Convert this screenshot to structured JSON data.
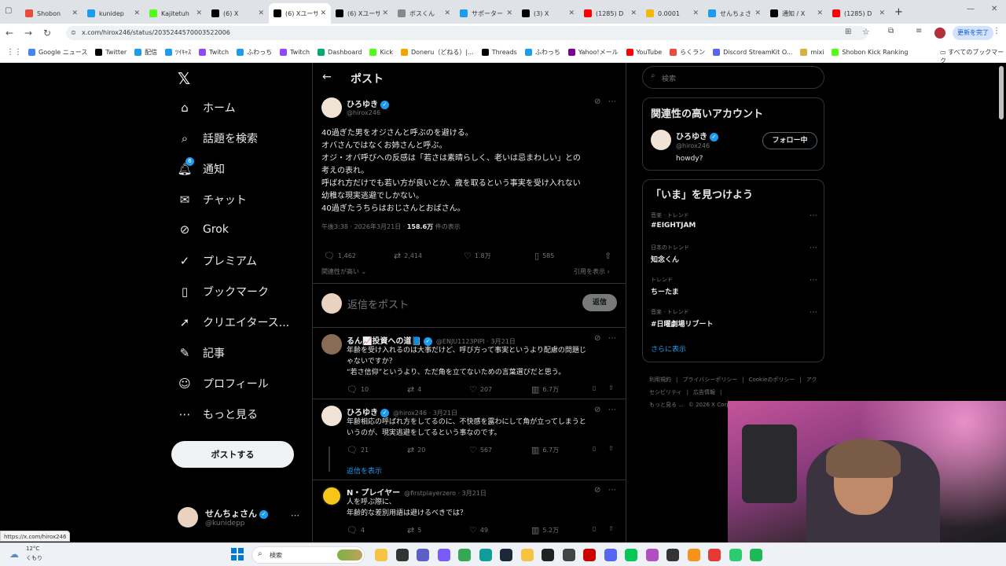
{
  "browser": {
    "tabs": [
      {
        "label": "Shobon",
        "color": "#e74c3c"
      },
      {
        "label": "kunidep",
        "color": "#1d9bf0"
      },
      {
        "label": "Kajitetuh",
        "color": "#53fc18"
      },
      {
        "label": "(6) X",
        "color": "#000"
      },
      {
        "label": "(6) Xユーザ",
        "color": "#000"
      },
      {
        "label": "(6) Xユーザ",
        "color": "#000"
      },
      {
        "label": "ボスくん",
        "color": "#888"
      },
      {
        "label": "サポーター",
        "color": "#1d9bf0"
      },
      {
        "label": "(3) X",
        "color": "#000"
      },
      {
        "label": "(1285) D",
        "color": "#ff0000"
      },
      {
        "label": "0.0001",
        "color": "#f0b90b"
      },
      {
        "label": "せんちょさ",
        "color": "#1d9bf0"
      },
      {
        "label": "通知 / X",
        "color": "#000"
      },
      {
        "label": "(1285) D",
        "color": "#ff0000"
      }
    ],
    "url": "x.com/hirox246/status/2035244570003522006",
    "update_label": "更新を完了",
    "bookmarks": [
      {
        "label": "Google ニュース",
        "color": "#4285f4"
      },
      {
        "label": "Twitter",
        "color": "#000"
      },
      {
        "label": "配信",
        "color": "#1d9bf0"
      },
      {
        "label": "ﾂｲｷｬｽ",
        "color": "#1d9bf0"
      },
      {
        "label": "Twitch",
        "color": "#9146ff"
      },
      {
        "label": "ふわっち",
        "color": "#1d9bf0"
      },
      {
        "label": "Twitch",
        "color": "#9146ff"
      },
      {
        "label": "Dashboard",
        "color": "#0a7"
      },
      {
        "label": "Kick",
        "color": "#53fc18"
      },
      {
        "label": "Doneru（どねる）|...",
        "color": "#f0a500"
      },
      {
        "label": "Threads",
        "color": "#000"
      },
      {
        "label": "ふわっち",
        "color": "#1d9bf0"
      },
      {
        "label": "Yahoo!メール",
        "color": "#7b0099"
      },
      {
        "label": "YouTube",
        "color": "#ff0000"
      },
      {
        "label": "らくラン",
        "color": "#e74c3c"
      },
      {
        "label": "Discord StreamKit O...",
        "color": "#5865f2"
      },
      {
        "label": "mixi",
        "color": "#d8b13d"
      },
      {
        "label": "Shobon Kick Ranking",
        "color": "#53fc18"
      }
    ],
    "all_bookmarks": "すべてのブックマーク"
  },
  "sidebar": {
    "items": [
      {
        "label": "ホーム",
        "icon": "home-icon",
        "glyph": "⌂"
      },
      {
        "label": "話題を検索",
        "icon": "search-icon",
        "glyph": "⌕"
      },
      {
        "label": "通知",
        "icon": "bell-icon",
        "glyph": "🔔︎"
      },
      {
        "label": "チャット",
        "icon": "mail-icon",
        "glyph": "✉"
      },
      {
        "label": "Grok",
        "icon": "grok-icon",
        "glyph": "⊘"
      },
      {
        "label": "プレミアム",
        "icon": "premium-icon",
        "glyph": "✓"
      },
      {
        "label": "ブックマーク",
        "icon": "bookmark-icon",
        "glyph": "▯"
      },
      {
        "label": "クリエイタース...",
        "icon": "rocket-icon",
        "glyph": "➚"
      },
      {
        "label": "記事",
        "icon": "article-icon",
        "glyph": "✎"
      },
      {
        "label": "プロフィール",
        "icon": "profile-icon",
        "glyph": "☺"
      },
      {
        "label": "もっと見る",
        "icon": "more-icon",
        "glyph": "⋯"
      }
    ],
    "notification_badge": "6",
    "post_button": "ポストする",
    "account": {
      "name": "せんちょさん",
      "handle": "@kunidepp"
    }
  },
  "header": {
    "title": "ポスト"
  },
  "post": {
    "author": "ひろゆき",
    "handle": "@hirox246",
    "lines": [
      "40過ぎた男をオジさんと呼ぶのを避ける。",
      "オバさんではなくお姉さんと呼ぶ。",
      "オジ・オバ呼びへの反感は「若さは素晴らしく、老いは忌まわしい」との",
      "考えの表れ。",
      "呼ばれ方だけでも若い方が良いとか、歳を取るという事実を受け入れない",
      "幼稚な現実逃避でしかない。",
      "40過ぎたうちらはおじさんとおばさん。"
    ],
    "time": "午後3:38 · 2026年3月21日 · ",
    "views": "158.6万",
    "views_suffix": " 件の表示",
    "replies": "1,462",
    "reposts": "2,414",
    "likes": "1.8万",
    "bookmarks": "585",
    "sort": "関連性が高い",
    "quotes": "引用を表示",
    "reply_placeholder": "返信をポスト",
    "reply_button": "返信"
  },
  "replies": [
    {
      "name": "るん📈投資への道📘",
      "handle": "@ENJU1123PIPI · 3月21日",
      "lines": [
        "年齢を受け入れるのは大事だけど、呼び方って事実というより配慮の問題じ",
        "ゃないですか？",
        "“若さ信仰”というより、ただ角を立てないための言葉選びだと思う。"
      ],
      "replies": "10",
      "reposts": "4",
      "likes": "207",
      "views": "6.7万"
    },
    {
      "name": "ひろゆき",
      "handle": "@hirox246 · 3月21日",
      "lines": [
        "年齢相応の呼ばれ方をしてるのに、不快感を露わにして角が立ってしまうと",
        "いうのが、現実逃避をしてるという事なのです。"
      ],
      "replies": "21",
      "reposts": "20",
      "likes": "567",
      "views": "6.7万"
    },
    {
      "name": "N・プレイヤー",
      "handle": "@firstplayerzero · 3月21日",
      "lines": [
        "人を呼ぶ際に、",
        "年齢的な差別用語は避けるべきでは？"
      ],
      "replies": "4",
      "reposts": "5",
      "likes": "49",
      "views": "5.2万"
    }
  ],
  "show_replies": "返信を表示",
  "right": {
    "search_placeholder": "検索",
    "related_title": "関連性の高いアカウント",
    "related": {
      "name": "ひろゆき",
      "handle": "@hirox246",
      "bio": "howdy?",
      "follow": "フォロー中"
    },
    "trends_title": "「いま」を見つけよう",
    "trends": [
      {
        "context": "音楽 · トレンド",
        "name": "#EIGHTJAM"
      },
      {
        "context": "日本のトレンド",
        "name": "知念くん"
      },
      {
        "context": "トレンド",
        "name": "ちーたま"
      },
      {
        "context": "音楽 · トレンド",
        "name": "#日曜劇場リブート"
      }
    ],
    "show_more": "さらに表示",
    "footer": [
      "利用規約",
      "|",
      "プライバシーポリシー",
      "|",
      "Cookieのポリシー",
      "|",
      "アクセシビリティ",
      "|",
      "広告情報",
      "|",
      "もっと見る ...",
      "© 2026 X Corp."
    ]
  },
  "status_url": "https://x.com/hirox246",
  "taskbar": {
    "temp": "12°C",
    "weather": "くもり",
    "search": "検索"
  }
}
